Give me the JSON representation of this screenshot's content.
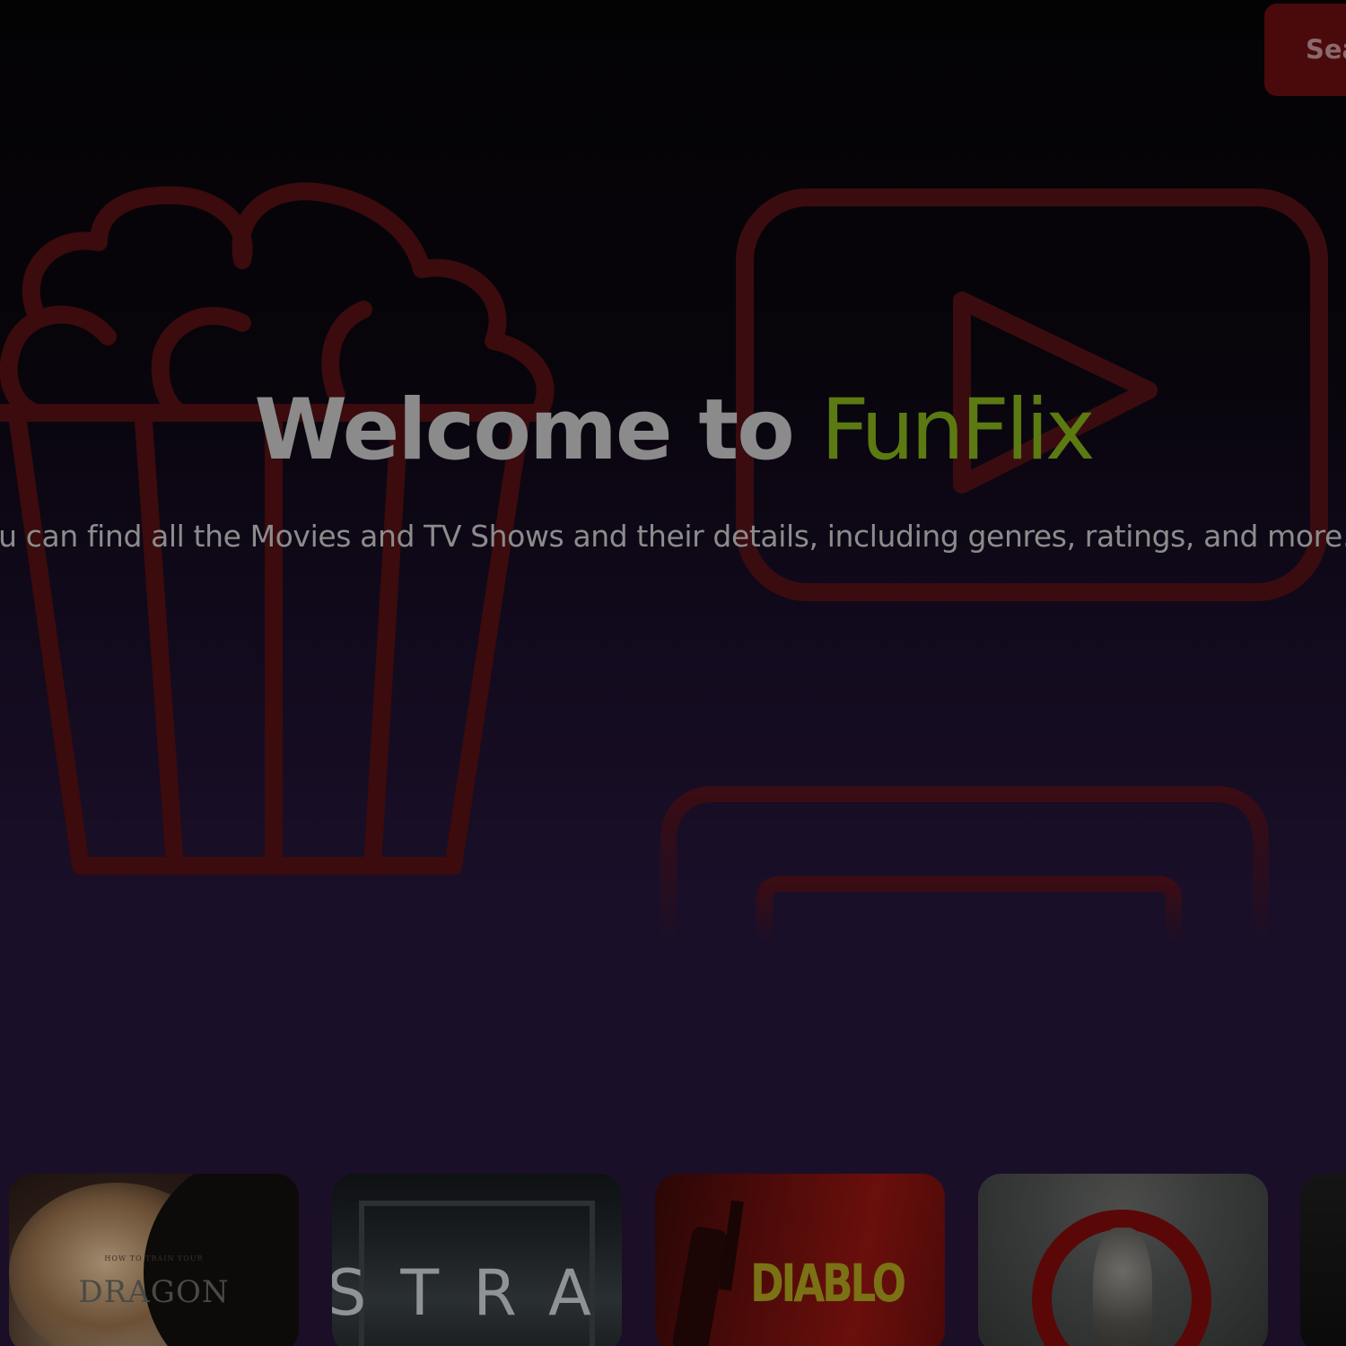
{
  "header": {
    "search_label": "Search"
  },
  "hero": {
    "title_prefix": "Welcome to ",
    "title_brand": "FunFlix",
    "subtitle": "You can find all the Movies and TV Shows and their details, including genres, ratings, and more."
  },
  "posters": [
    {
      "title": "DRAGON",
      "tagline": "HOW TO TRAIN YOUR"
    },
    {
      "title": "STRAW"
    },
    {
      "title": "DIABLO"
    },
    {
      "title": ""
    },
    {
      "title": ""
    }
  ],
  "colors": {
    "brand": "#5b7a12",
    "accent_red": "#4a0a0c",
    "icon_stroke": "#3a0c12"
  },
  "icons": {
    "popcorn": "popcorn-icon",
    "play": "play-icon",
    "tv": "tv-icon"
  }
}
